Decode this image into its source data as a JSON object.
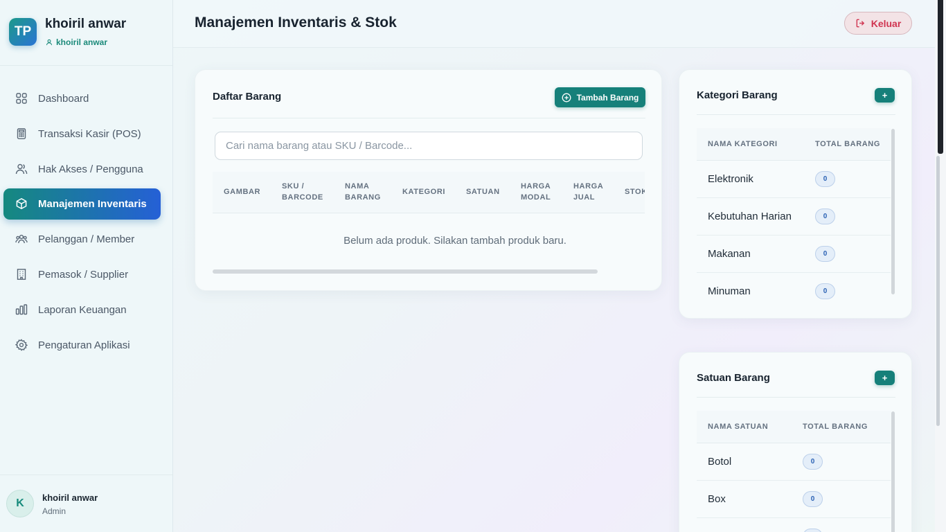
{
  "sidebar": {
    "brand_initials": "TP",
    "brand_name": "khoiril anwar",
    "brand_sub": "khoiril anwar",
    "items": [
      {
        "label": "Dashboard",
        "icon": "grid-icon"
      },
      {
        "label": "Transaksi Kasir (POS)",
        "icon": "calculator-icon"
      },
      {
        "label": "Hak Akses / Pengguna",
        "icon": "users-icon"
      },
      {
        "label": "Manajemen Inventaris",
        "icon": "box-icon",
        "active": true
      },
      {
        "label": "Pelanggan / Member",
        "icon": "group-icon"
      },
      {
        "label": "Pemasok / Supplier",
        "icon": "building-icon"
      },
      {
        "label": "Laporan Keuangan",
        "icon": "bar-chart-icon"
      },
      {
        "label": "Pengaturan Aplikasi",
        "icon": "gear-icon"
      }
    ],
    "user": {
      "initial": "K",
      "name": "khoiril anwar",
      "role": "Admin"
    }
  },
  "header": {
    "title": "Manajemen Inventaris & Stok",
    "logout_label": "Keluar"
  },
  "products": {
    "title": "Daftar Barang",
    "add_label": "Tambah Barang",
    "search_placeholder": "Cari nama barang atau SKU / Barcode...",
    "columns": [
      [
        "GAMBAR"
      ],
      [
        "SKU /",
        "BARCODE"
      ],
      [
        "NAMA",
        "BARANG"
      ],
      [
        "KATEGORI"
      ],
      [
        "SATUAN"
      ],
      [
        "HARGA",
        "MODAL"
      ],
      [
        "HARGA",
        "JUAL"
      ],
      [
        "STOK"
      ]
    ],
    "empty_message": "Belum ada produk. Silakan tambah produk baru."
  },
  "categories": {
    "title": "Kategori Barang",
    "add_label": "+",
    "col_name": "NAMA KATEGORI",
    "col_total": "TOTAL BARANG",
    "rows": [
      {
        "name": "Elektronik",
        "total": "0"
      },
      {
        "name": "Kebutuhan Harian",
        "total": "0"
      },
      {
        "name": "Makanan",
        "total": "0"
      },
      {
        "name": "Minuman",
        "total": "0"
      }
    ]
  },
  "units": {
    "title": "Satuan Barang",
    "add_label": "+",
    "col_name": "NAMA SATUAN",
    "col_total": "TOTAL BARANG",
    "rows": [
      {
        "name": "Botol",
        "total": "0"
      },
      {
        "name": "Box",
        "total": "0"
      }
    ]
  },
  "colors": {
    "accent": "#16807a",
    "active_gradient_start": "#15897f",
    "active_gradient_end": "#2560d6",
    "logout": "#d03450"
  }
}
